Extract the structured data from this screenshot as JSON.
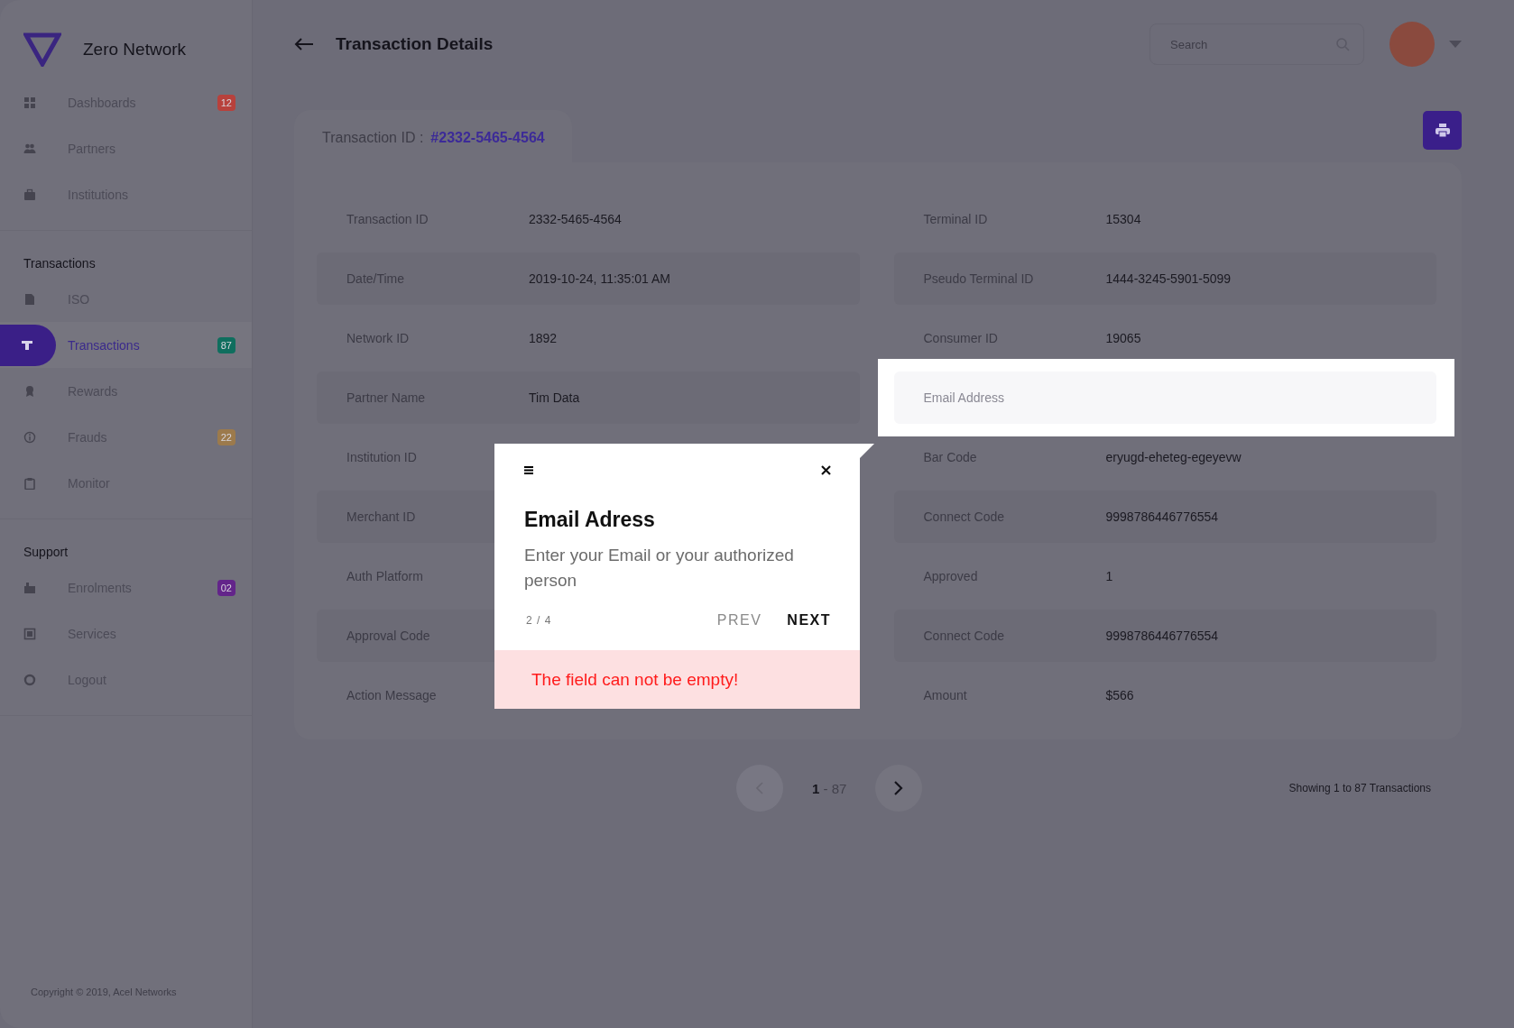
{
  "sidebar": {
    "brand": "Zero Network",
    "sections": [
      {
        "items": [
          {
            "label": "Dashboards",
            "selected": false,
            "badge": "12",
            "color": "#b8413c"
          },
          {
            "label": "Partners",
            "selected": false
          },
          {
            "label": "Institutions",
            "selected": false
          }
        ]
      },
      {
        "title": "Transactions",
        "items": [
          {
            "label": "ISO",
            "selected": false
          },
          {
            "label": "Transactions",
            "selected": true,
            "badge": "87",
            "color": "#0f6e5e"
          },
          {
            "label": "Rewards",
            "selected": false
          },
          {
            "label": "Frauds",
            "selected": false,
            "badge": "22",
            "color": "#9c7a4c"
          },
          {
            "label": "Monitor",
            "selected": false
          }
        ]
      },
      {
        "title": "Support",
        "items": [
          {
            "label": "Enrolments",
            "selected": false,
            "badge": "02",
            "color": "#63248a"
          },
          {
            "label": "Services",
            "selected": false
          },
          {
            "label": "Logout",
            "selected": false
          }
        ]
      }
    ],
    "copyright": "Copyright © 2019, Acel Networks"
  },
  "header": {
    "title": "Transaction Details",
    "search": {
      "placeholder": "Search"
    }
  },
  "tab": {
    "label": "Transaction ID :",
    "value": "#2332-5465-4564"
  },
  "details": {
    "left": [
      {
        "label": "Transaction ID",
        "value": "2332-5465-4564",
        "highlighted": false
      },
      {
        "label": "Date/Time",
        "value": "2019-10-24, 11:35:01 AM",
        "highlighted": false
      },
      {
        "label": "Network ID",
        "value": "1892",
        "highlighted": false
      },
      {
        "label": "Partner Name",
        "value": "Tim Data",
        "highlighted": false
      },
      {
        "label": "Institution ID",
        "highlighted": false
      },
      {
        "label": "Merchant ID",
        "highlighted": false
      },
      {
        "label": "Auth Platform",
        "highlighted": false
      },
      {
        "label": "Approval Code",
        "highlighted": false
      },
      {
        "label": "Action Message",
        "highlighted": false
      }
    ],
    "right": [
      {
        "label": "Terminal ID",
        "value": "15304",
        "highlighted": false
      },
      {
        "label": "Pseudo Terminal ID",
        "value": "1444-3245-5901-5099",
        "highlighted": false
      },
      {
        "label": "Consumer ID",
        "value": "19065",
        "highlighted": false
      },
      {
        "label": "Email Address",
        "highlighted": true
      },
      {
        "label": "Bar Code",
        "value": "eryugd-eheteg-egeyevw",
        "highlighted": false
      },
      {
        "label": "Connect Code",
        "value": "9998786446776554",
        "highlighted": false
      },
      {
        "label": "Approved",
        "value": "1",
        "highlighted": false
      },
      {
        "label": "Connect Code",
        "value": "9998786446776554",
        "highlighted": false
      },
      {
        "label": "Amount",
        "value": "$566",
        "highlighted": false
      }
    ]
  },
  "pagination": {
    "pages": "**1** - 87",
    "summary": "Showing 1 to 87 Transactions"
  },
  "tour": {
    "title": "Email Adress",
    "text": "Enter your Email or your authorized person",
    "step": "2 / 4",
    "prev": "PREV",
    "next": "NEXT",
    "error": "The field can not be empty!"
  }
}
